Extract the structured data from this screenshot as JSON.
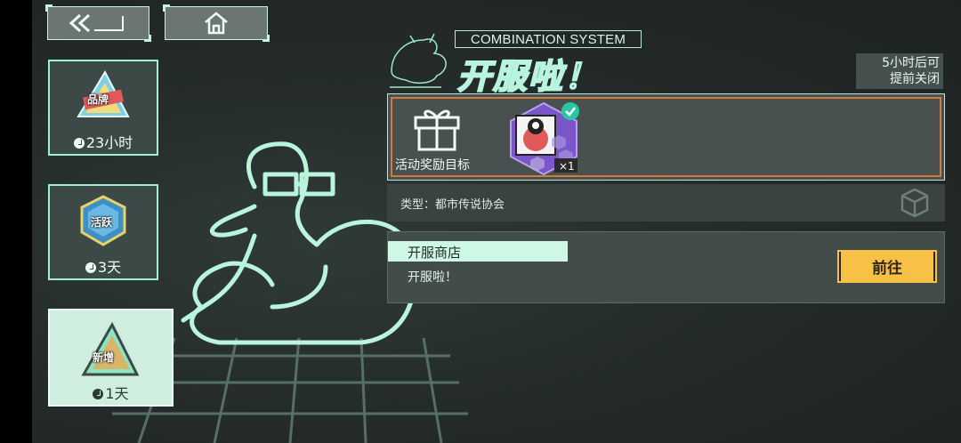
{
  "nav": {
    "back_icon": "back-arrow-icon",
    "home_icon": "home-icon"
  },
  "events": [
    {
      "badge": "品牌",
      "timer": "23小时"
    },
    {
      "badge": "活跃",
      "timer": "3天"
    },
    {
      "badge": "新增",
      "timer": "1天"
    }
  ],
  "header": {
    "subtitle": "COMBINATION SYSTEM",
    "title": "开服啦！",
    "close_note_line1": "5小时后可",
    "close_note_line2": "提前关闭"
  },
  "reward": {
    "gift_label": "活动奖励目标",
    "item_count": "×1"
  },
  "type_row": {
    "text": "类型：都市传说协会"
  },
  "shop": {
    "title": "开服商店",
    "desc": "开服啦！",
    "go_label": "前往"
  },
  "colors": {
    "accent": "#9ff0d6",
    "button": "#f8c146",
    "reward_border": "#d17a3a",
    "item_bg": "#7b56c8"
  }
}
